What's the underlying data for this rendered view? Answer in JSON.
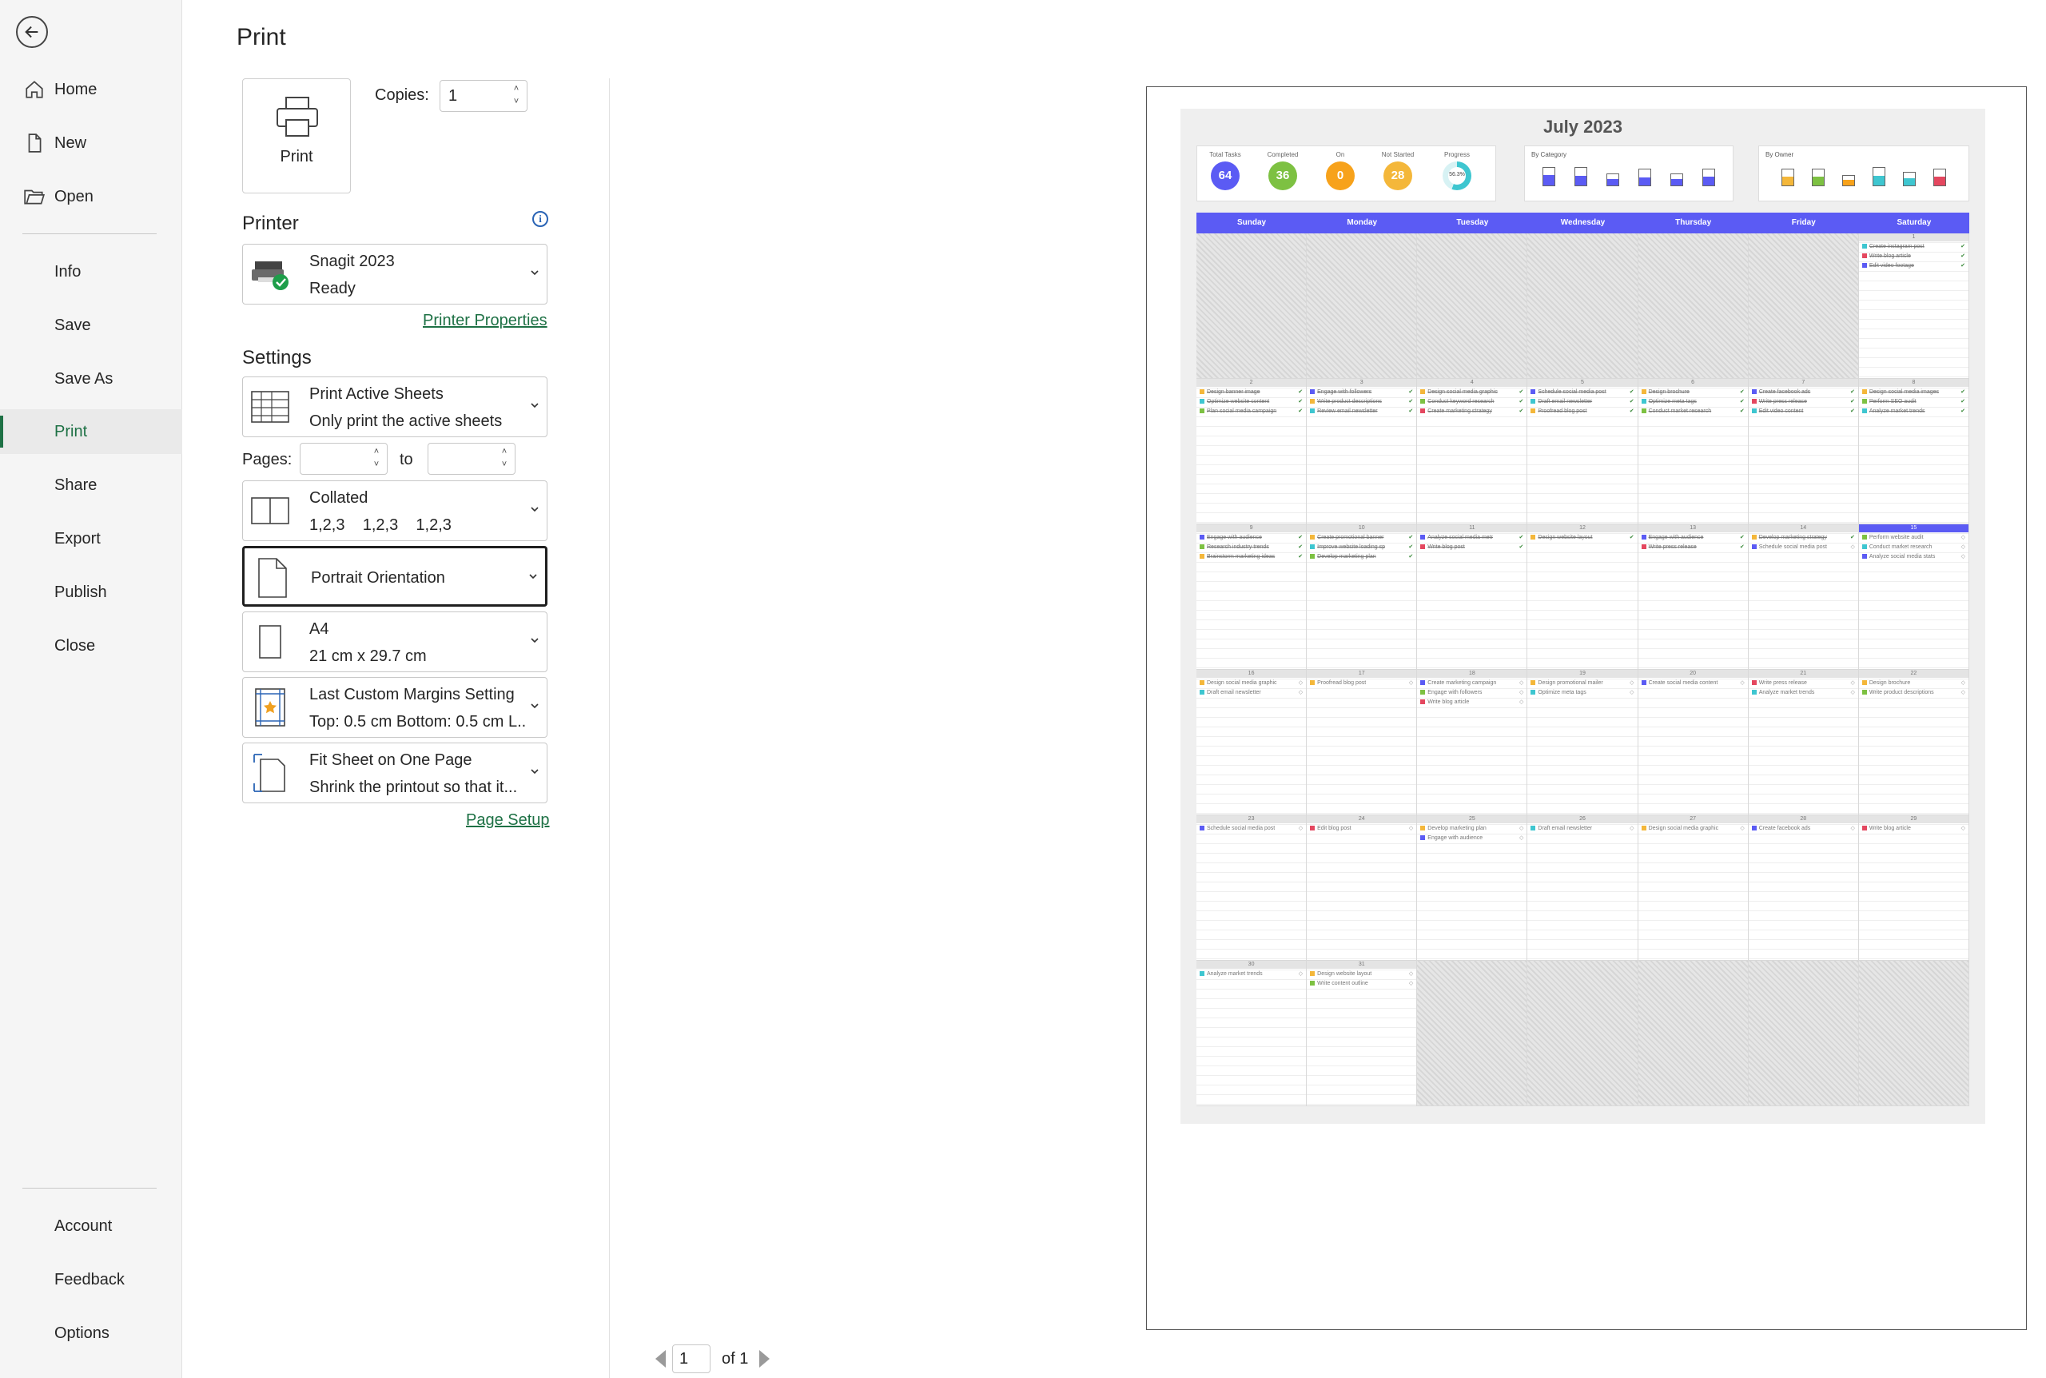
{
  "nav": {
    "items_top": [
      {
        "label": "Home",
        "icon": "home-icon"
      },
      {
        "label": "New",
        "icon": "new-document-icon"
      },
      {
        "label": "Open",
        "icon": "open-folder-icon"
      }
    ],
    "items_mid": [
      "Info",
      "Save",
      "Save As",
      "Print",
      "Share",
      "Export",
      "Publish",
      "Close"
    ],
    "active": "Print",
    "items_bottom": [
      "Account",
      "Feedback",
      "Options"
    ]
  },
  "print": {
    "title": "Print",
    "print_button_label": "Print",
    "copies_label": "Copies:",
    "copies_value": "1"
  },
  "printer": {
    "heading": "Printer",
    "name": "Snagit 2023",
    "status": "Ready",
    "properties_link": "Printer Properties"
  },
  "settings": {
    "heading": "Settings",
    "what": {
      "line1": "Print Active Sheets",
      "line2": "Only print the active sheets"
    },
    "pages_label": "Pages:",
    "to_label": "to",
    "collation": {
      "line1": "Collated",
      "line2": "1,2,3    1,2,3    1,2,3"
    },
    "orientation": {
      "line1": "Portrait Orientation"
    },
    "paper": {
      "line1": "A4",
      "line2": "21 cm x 29.7 cm"
    },
    "margins": {
      "line1": "Last Custom Margins Setting",
      "line2": "Top: 0.5 cm Bottom: 0.5 cm L..."
    },
    "scaling": {
      "line1": "Fit Sheet on One Page",
      "line2": "Shrink the printout so that it..."
    },
    "page_setup_link": "Page Setup"
  },
  "pager": {
    "current": "1",
    "of_text": "of 1"
  },
  "calendar": {
    "title": "July 2023",
    "kpis": [
      {
        "label": "Total Tasks",
        "value": "64",
        "color": "#5b5bf4"
      },
      {
        "label": "Completed",
        "value": "36",
        "color": "#7dc142"
      },
      {
        "label": "On",
        "value": "0",
        "color": "#f7a21b"
      },
      {
        "label": "Not Started",
        "value": "28",
        "color": "#f4b73a"
      },
      {
        "label": "Progress",
        "value": "56.3%",
        "color": "#3ec6d0"
      }
    ],
    "category_heading": "By Category",
    "owner_heading": "By Owner",
    "weekdays": [
      "Sunday",
      "Monday",
      "Tuesday",
      "Wednesday",
      "Thursday",
      "Friday",
      "Saturday"
    ],
    "today": "15",
    "days": [
      {
        "d": "1",
        "tasks": [
          [
            "Create instagram post",
            1,
            "#3ec6d0"
          ],
          [
            "Write blog article",
            1,
            "#e4475f"
          ],
          [
            "Edit video footage",
            1,
            "#5b5bf4"
          ]
        ]
      },
      {
        "d": "2",
        "tasks": [
          [
            "Design banner image",
            1,
            "#f4b73a"
          ],
          [
            "Optimize website content",
            1,
            "#3ec6d0"
          ],
          [
            "Plan social media campaign",
            1,
            "#7dc142"
          ]
        ]
      },
      {
        "d": "3",
        "tasks": [
          [
            "Engage with followers",
            1,
            "#5b5bf4"
          ],
          [
            "Write product descriptions",
            1,
            "#f4b73a"
          ],
          [
            "Review email newsletter",
            1,
            "#3ec6d0"
          ]
        ]
      },
      {
        "d": "4",
        "tasks": [
          [
            "Design social media graphic",
            1,
            "#f4b73a"
          ],
          [
            "Conduct keyword research",
            1,
            "#7dc142"
          ],
          [
            "Create marketing strategy",
            1,
            "#e4475f"
          ]
        ]
      },
      {
        "d": "5",
        "tasks": [
          [
            "Schedule social media post",
            1,
            "#5b5bf4"
          ],
          [
            "Draft email newsletter",
            1,
            "#3ec6d0"
          ],
          [
            "Proofread blog post",
            1,
            "#f4b73a"
          ]
        ]
      },
      {
        "d": "6",
        "tasks": [
          [
            "Design brochure",
            1,
            "#f4b73a"
          ],
          [
            "Optimize meta tags",
            1,
            "#3ec6d0"
          ],
          [
            "Conduct market research",
            1,
            "#7dc142"
          ]
        ]
      },
      {
        "d": "7",
        "tasks": [
          [
            "Create facebook ads",
            1,
            "#5b5bf4"
          ],
          [
            "Write press release",
            1,
            "#e4475f"
          ],
          [
            "Edit video content",
            1,
            "#3ec6d0"
          ]
        ]
      },
      {
        "d": "8",
        "tasks": [
          [
            "Design social media images",
            1,
            "#f4b73a"
          ],
          [
            "Perform SEO audit",
            1,
            "#7dc142"
          ],
          [
            "Analyze market trends",
            1,
            "#3ec6d0"
          ]
        ]
      },
      {
        "d": "9",
        "tasks": [
          [
            "Engage with audience",
            1,
            "#5b5bf4"
          ],
          [
            "Research industry trends",
            1,
            "#7dc142"
          ],
          [
            "Brainstorm marketing ideas",
            1,
            "#f4b73a"
          ]
        ]
      },
      {
        "d": "10",
        "tasks": [
          [
            "Create promotional banner",
            1,
            "#f4b73a"
          ],
          [
            "Improve website loading sp",
            1,
            "#3ec6d0"
          ],
          [
            "Develop marketing plan",
            1,
            "#7dc142"
          ]
        ]
      },
      {
        "d": "11",
        "tasks": [
          [
            "Analyze social media metr",
            1,
            "#5b5bf4"
          ],
          [
            "Write blog post",
            1,
            "#e4475f"
          ]
        ]
      },
      {
        "d": "12",
        "tasks": [
          [
            "Design website layout",
            1,
            "#f4b73a"
          ]
        ]
      },
      {
        "d": "13",
        "tasks": [
          [
            "Engage with audience",
            1,
            "#5b5bf4"
          ],
          [
            "Write press release",
            1,
            "#e4475f"
          ]
        ]
      },
      {
        "d": "14",
        "tasks": [
          [
            "Develop marketing strategy",
            1,
            "#f4b73a"
          ],
          [
            "Schedule social media post",
            0,
            "#5b5bf4"
          ]
        ]
      },
      {
        "d": "15",
        "tasks": [
          [
            "Perform website audit",
            0,
            "#7dc142"
          ],
          [
            "Conduct market research",
            0,
            "#3ec6d0"
          ],
          [
            "Analyze social media stats",
            0,
            "#5b5bf4"
          ]
        ]
      },
      {
        "d": "16",
        "tasks": [
          [
            "Design social media graphic",
            0,
            "#f4b73a"
          ],
          [
            "Draft email newsletter",
            0,
            "#3ec6d0"
          ]
        ]
      },
      {
        "d": "17",
        "tasks": [
          [
            "Proofread blog post",
            0,
            "#f4b73a"
          ]
        ]
      },
      {
        "d": "18",
        "tasks": [
          [
            "Create marketing campaign",
            0,
            "#5b5bf4"
          ],
          [
            "Engage with followers",
            0,
            "#7dc142"
          ],
          [
            "Write blog article",
            0,
            "#e4475f"
          ]
        ]
      },
      {
        "d": "19",
        "tasks": [
          [
            "Design promotional mailer",
            0,
            "#f4b73a"
          ],
          [
            "Optimize meta tags",
            0,
            "#3ec6d0"
          ]
        ]
      },
      {
        "d": "20",
        "tasks": [
          [
            "Create social media content",
            0,
            "#5b5bf4"
          ]
        ]
      },
      {
        "d": "21",
        "tasks": [
          [
            "Write press release",
            0,
            "#e4475f"
          ],
          [
            "Analyze market trends",
            0,
            "#3ec6d0"
          ]
        ]
      },
      {
        "d": "22",
        "tasks": [
          [
            "Design brochure",
            0,
            "#f4b73a"
          ],
          [
            "Write product descriptions",
            0,
            "#7dc142"
          ]
        ]
      },
      {
        "d": "23",
        "tasks": [
          [
            "Schedule social media post",
            0,
            "#5b5bf4"
          ]
        ]
      },
      {
        "d": "24",
        "tasks": [
          [
            "Edit blog post",
            0,
            "#e4475f"
          ]
        ]
      },
      {
        "d": "25",
        "tasks": [
          [
            "Develop marketing plan",
            0,
            "#f4b73a"
          ],
          [
            "Engage with audience",
            0,
            "#5b5bf4"
          ]
        ]
      },
      {
        "d": "26",
        "tasks": [
          [
            "Draft email newsletter",
            0,
            "#3ec6d0"
          ]
        ]
      },
      {
        "d": "27",
        "tasks": [
          [
            "Design social media graphic",
            0,
            "#f4b73a"
          ]
        ]
      },
      {
        "d": "28",
        "tasks": [
          [
            "Create facebook ads",
            0,
            "#5b5bf4"
          ]
        ]
      },
      {
        "d": "29",
        "tasks": [
          [
            "Write blog article",
            0,
            "#e4475f"
          ]
        ]
      },
      {
        "d": "30",
        "tasks": [
          [
            "Analyze market trends",
            0,
            "#3ec6d0"
          ]
        ]
      },
      {
        "d": "31",
        "tasks": [
          [
            "Design website layout",
            0,
            "#f4b73a"
          ],
          [
            "Write content outline",
            0,
            "#7dc142"
          ]
        ]
      }
    ]
  },
  "colors": {
    "accent": "#1e7145",
    "link": "#1e7145",
    "calendar_header": "#5b5bf4"
  }
}
